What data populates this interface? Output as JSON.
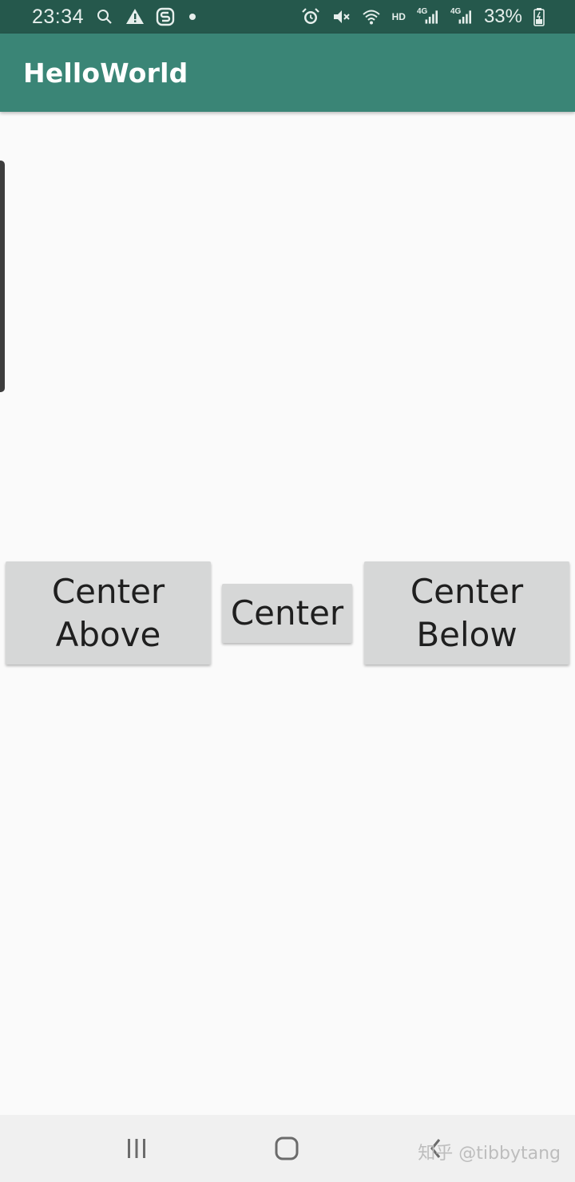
{
  "status_bar": {
    "time": "23:34",
    "left_icons": [
      "search-icon",
      "warning-icon",
      "s-app-icon",
      "notification-dot"
    ],
    "right_icons": [
      "alarm-icon",
      "mute-icon",
      "vibrate-off-icon",
      "wifi-icon",
      "hd-icon",
      "signal-4g-icon",
      "signal-4g-icon"
    ],
    "hd_label": "HD",
    "network_label_1": "4G",
    "network_label_2": "4G",
    "battery": "33%"
  },
  "app_bar": {
    "title": "HelloWorld",
    "color": "#3a8576"
  },
  "buttons": {
    "above": "Center\nAbove",
    "center": "Center",
    "below": "Center\nBelow"
  },
  "nav_bar": {
    "icons": [
      "recent-apps-icon",
      "home-icon",
      "back-icon"
    ]
  },
  "watermark": "知乎 @tibbytang"
}
